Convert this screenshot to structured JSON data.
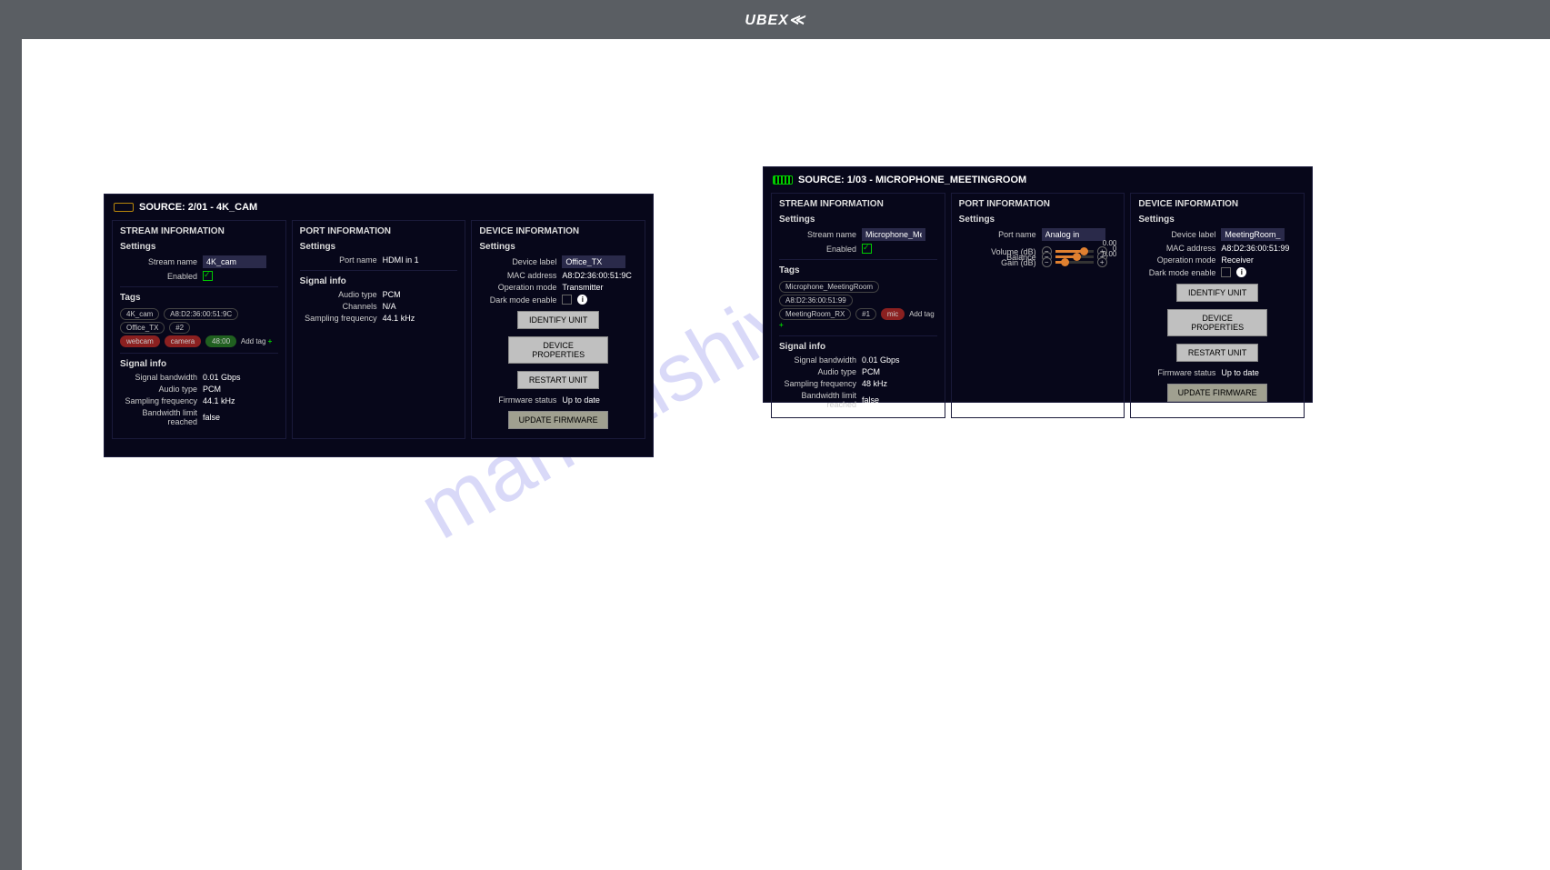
{
  "brand": "UBEX",
  "watermark": "manualshive.com",
  "labels": {
    "stream_info": "STREAM INFORMATION",
    "port_info": "PORT INFORMATION",
    "device_info": "DEVICE INFORMATION",
    "settings": "Settings",
    "signal_info": "Signal info",
    "tags": "Tags",
    "stream_name": "Stream name",
    "enabled": "Enabled",
    "port_name": "Port name",
    "audio_type": "Audio type",
    "channels": "Channels",
    "sampling_freq": "Sampling frequency",
    "device_label": "Device label",
    "mac": "MAC address",
    "op_mode": "Operation mode",
    "dark_mode": "Dark mode enable",
    "signal_bw": "Signal bandwidth",
    "bw_limit": "Bandwidth limit reached",
    "volume": "Volume (dB)",
    "balance": "Balance",
    "gain": "Gain (dB)",
    "fw_status": "Firmware status",
    "identify": "IDENTIFY UNIT",
    "dev_props": "DEVICE PROPERTIES",
    "restart": "RESTART UNIT",
    "update_fw": "UPDATE FIRMWARE",
    "add_tag": "Add tag"
  },
  "p1": {
    "title": "SOURCE: 2/01 - 4K_CAM",
    "stream_name": "4K_cam",
    "tags": [
      "4K_cam",
      "A8:D2:36:00:51:9C",
      "Office_TX",
      "#2"
    ],
    "tags2": [
      {
        "t": "webcam",
        "c": "red"
      },
      {
        "t": "camera",
        "c": "red"
      },
      {
        "t": "48:00",
        "c": "green"
      }
    ],
    "signal_bw": "0.01 Gbps",
    "audio_type": "PCM",
    "sampling": "44.1 kHz",
    "bw_limit": "false",
    "port_name": "HDMI in 1",
    "p_audio_type": "PCM",
    "p_channels": "N/A",
    "p_sampling": "44.1 kHz",
    "device_label": "Office_TX",
    "mac": "A8:D2:36:00:51:9C",
    "op_mode": "Transmitter",
    "fw_status": "Up to date"
  },
  "p2": {
    "title": "SOURCE: 1/03 - MICROPHONE_MEETINGROOM",
    "stream_name": "Microphone_MeetingRoom",
    "tags": [
      "Microphone_MeetingRoom",
      "A8:D2:36:00:51:99"
    ],
    "tags2": [
      {
        "t": "MeetingRoom_RX",
        "c": ""
      },
      {
        "t": "#1",
        "c": ""
      },
      {
        "t": "mic",
        "c": "red"
      }
    ],
    "signal_bw": "0.01 Gbps",
    "audio_type": "PCM",
    "sampling": "48 kHz",
    "bw_limit": "false",
    "port_name": "Analog in",
    "volume": "0.00",
    "balance": "0",
    "gain": "0.00",
    "device_label": "MeetingRoom_RX",
    "mac": "A8:D2:36:00:51:99",
    "op_mode": "Receiver",
    "fw_status": "Up to date"
  }
}
